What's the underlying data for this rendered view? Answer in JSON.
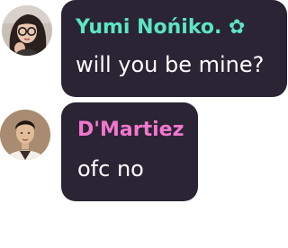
{
  "messages": [
    {
      "author": "Yumi Nońiko. ✿",
      "text": "will you be mine?",
      "name_color": "#5ce6c3",
      "avatar_icon": "user-avatar-woman-glasses"
    },
    {
      "author": "D'Martiez",
      "text": "ofc no",
      "name_color": "#f277cf",
      "avatar_icon": "user-avatar-man"
    }
  ],
  "colors": {
    "bubble": "#2b2434",
    "message_text": "#ffffff",
    "background": "#ffffff"
  }
}
